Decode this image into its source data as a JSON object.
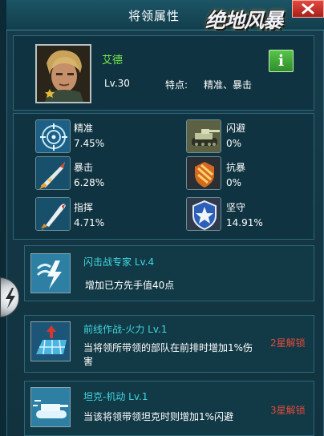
{
  "header": {
    "title": "将领属性",
    "logo_text": "绝地风暴",
    "close_icon": "close-x-icon"
  },
  "general": {
    "name": "艾德",
    "level": "Lv.30",
    "trait_label": "特点:",
    "trait_value": "精准、暴击",
    "info_label": "i"
  },
  "stats": [
    {
      "label": "精准",
      "value": "7.45%",
      "icon": "crosshair-icon"
    },
    {
      "label": "闪避",
      "value": "0%",
      "icon": "tank-icon"
    },
    {
      "label": "暴击",
      "value": "6.28%",
      "icon": "missile-icon"
    },
    {
      "label": "抗暴",
      "value": "0%",
      "icon": "armor-shield-icon"
    },
    {
      "label": "指挥",
      "value": "4.71%",
      "icon": "rocket-icon"
    },
    {
      "label": "坚守",
      "value": "14.91%",
      "icon": "star-shield-icon"
    }
  ],
  "skills": [
    {
      "name": "闪击战专家 Lv.4",
      "desc": "增加已方先手值40点",
      "unlock": "",
      "icon": "lightning-icon"
    },
    {
      "name": "前线作战-火力 Lv.1",
      "desc": "当将领所带领的部队在前排时增加1%伤害",
      "unlock": "2星解锁",
      "icon": "grid-arrow-icon"
    },
    {
      "name": "坦克-机动 Lv.1",
      "desc": "当该将领带领坦克时则增加1%闪避",
      "unlock": "3星解锁",
      "icon": "tank-skill-icon"
    }
  ],
  "colors": {
    "panel_bg": "#12323f",
    "name_green": "#78e84c",
    "skill_cyan": "#3fd7e0",
    "unlock_red": "#e34a3b",
    "info_green": "#3fa636"
  }
}
